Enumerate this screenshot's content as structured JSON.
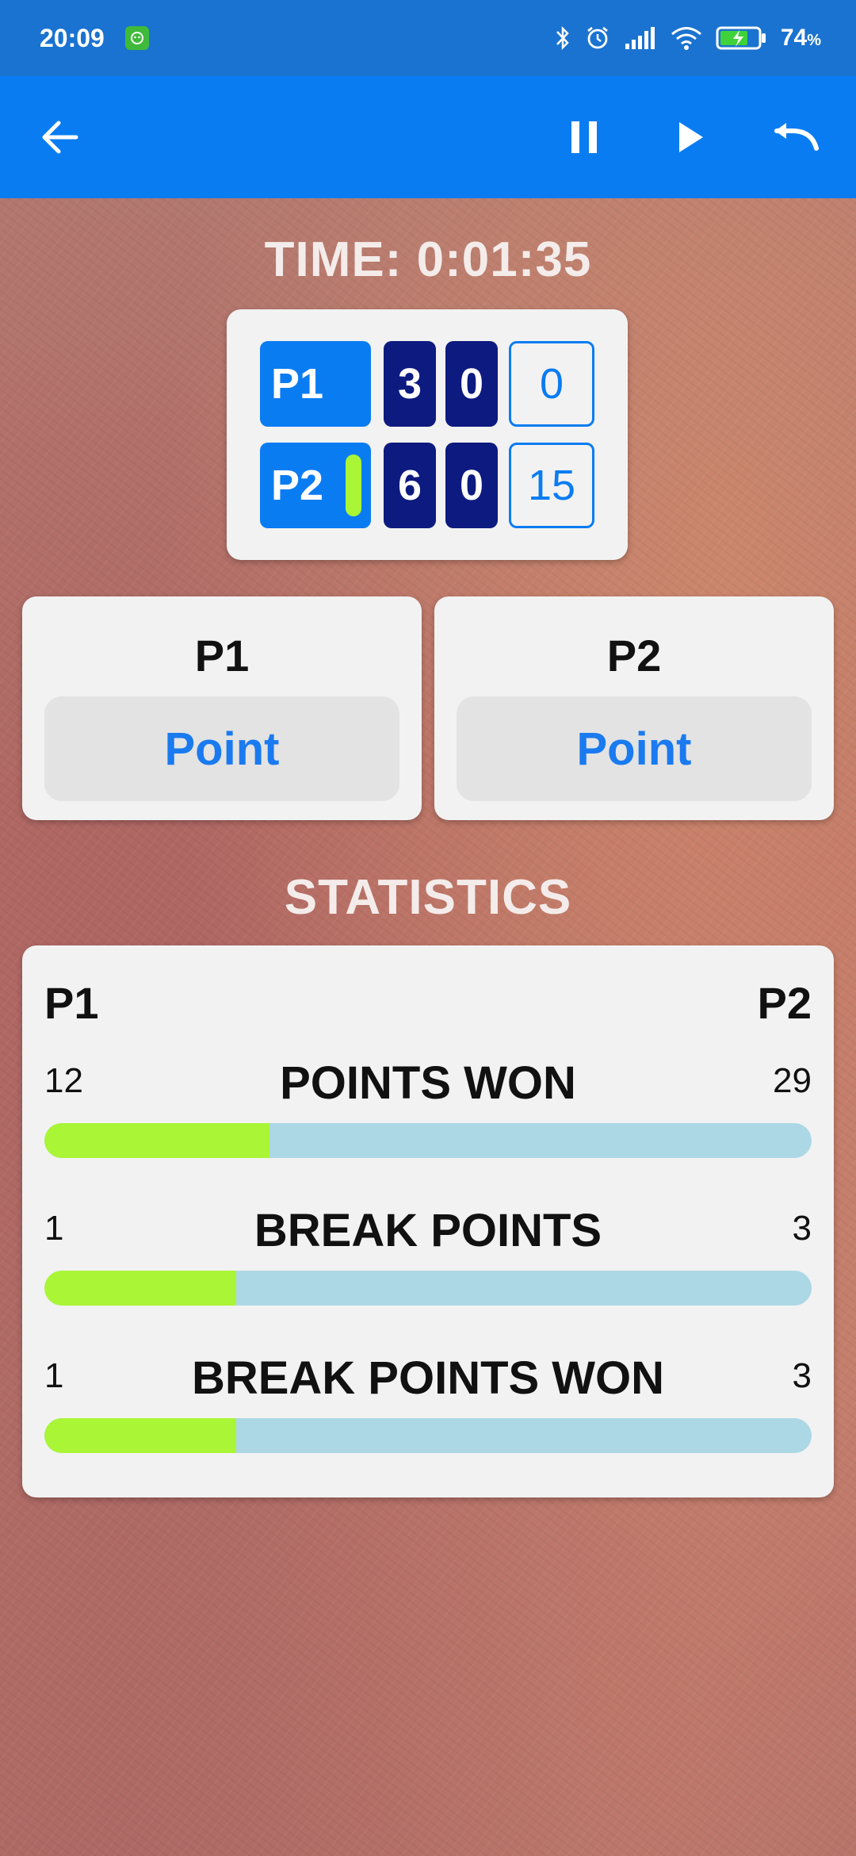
{
  "status_bar": {
    "time": "20:09",
    "battery_percent": "74",
    "battery_unit": "%",
    "icons": [
      "app-notification-icon",
      "bluetooth-icon",
      "alarm-icon",
      "signal-icon",
      "wifi-icon",
      "battery-charging-icon"
    ]
  },
  "app_bar": {
    "icons": [
      "back-arrow-icon",
      "pause-icon",
      "play-icon",
      "undo-icon"
    ],
    "color": "#0a7cf2"
  },
  "timer": {
    "label": "TIME: 0:01:35"
  },
  "scoreboard": {
    "players": [
      {
        "name": "P1",
        "sets": [
          "3",
          "0"
        ],
        "points": "0",
        "serving": false
      },
      {
        "name": "P2",
        "sets": [
          "6",
          "0"
        ],
        "points": "15",
        "serving": true
      }
    ]
  },
  "point_buttons": [
    {
      "player": "P1",
      "label": "Point"
    },
    {
      "player": "P2",
      "label": "Point"
    }
  ],
  "statistics": {
    "title": "STATISTICS",
    "left_player": "P1",
    "right_player": "P2",
    "rows": [
      {
        "label": "POINTS WON",
        "left": "12",
        "right": "29",
        "left_share": 0.293
      },
      {
        "label": "BREAK POINTS",
        "left": "1",
        "right": "3",
        "left_share": 0.25
      },
      {
        "label": "BREAK POINTS WON",
        "left": "1",
        "right": "3",
        "left_share": 0.25
      }
    ],
    "colors": {
      "p1_bar": "#aaf536",
      "p2_bar": "#acd8e6"
    }
  }
}
